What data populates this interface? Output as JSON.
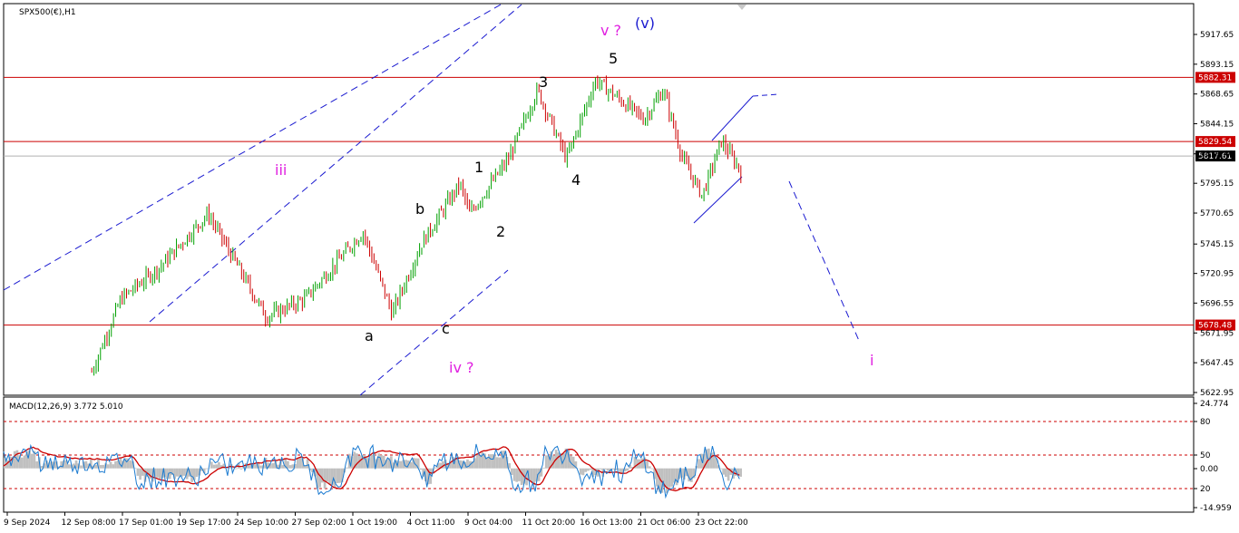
{
  "window": {
    "symbol_label": "SPX500(€),H1",
    "indicator_label": "MACD(12,26,9) 3.772 5.010"
  },
  "chart_data": [
    {
      "type": "candlestick",
      "title": "SPX500(€),H1",
      "ylim": [
        5622.95,
        5935
      ],
      "y_ticks": [
        "5917.65",
        "5893.15",
        "5868.65",
        "5844.15",
        "5819.40",
        "5795.15",
        "5770.65",
        "5745.15",
        "5720.95",
        "5696.55",
        "5671.95",
        "5647.45",
        "5622.95"
      ],
      "x_ticks": [
        "9 Sep 2024",
        "12 Sep 08:00",
        "17 Sep 01:00",
        "19 Sep 17:00",
        "24 Sep 10:00",
        "27 Sep 02:00",
        "1 Oct 19:00",
        "4 Oct 11:00",
        "9 Oct 04:00",
        "11 Oct 20:00",
        "16 Oct 13:00",
        "21 Oct 06:00",
        "23 Oct 22:00"
      ],
      "horizontal_levels": [
        {
          "price": 5882.31,
          "label": "5882.31",
          "color": "#cc0000"
        },
        {
          "price": 5829.54,
          "label": "5829.54",
          "color": "#cc0000"
        },
        {
          "price": 5817.61,
          "label": "5817.61",
          "color": "#000000"
        },
        {
          "price": 5678.48,
          "label": "5678.48",
          "color": "#cc0000"
        }
      ],
      "key_points": [
        {
          "x": 0,
          "price": 5640
        },
        {
          "x": 3,
          "price": 5700
        },
        {
          "x": 7,
          "price": 5726
        },
        {
          "x": 12,
          "price": 5770
        },
        {
          "x": 18,
          "price": 5685
        },
        {
          "x": 22,
          "price": 5700
        },
        {
          "x": 28,
          "price": 5755
        },
        {
          "x": 31,
          "price": 5688
        },
        {
          "x": 34,
          "price": 5745
        },
        {
          "x": 38,
          "price": 5795
        },
        {
          "x": 39,
          "price": 5770
        },
        {
          "x": 43,
          "price": 5815
        },
        {
          "x": 46,
          "price": 5872
        },
        {
          "x": 49,
          "price": 5815
        },
        {
          "x": 52,
          "price": 5880
        },
        {
          "x": 57,
          "price": 5848
        },
        {
          "x": 59,
          "price": 5872
        },
        {
          "x": 61,
          "price": 5815
        },
        {
          "x": 63,
          "price": 5785
        },
        {
          "x": 65,
          "price": 5830
        },
        {
          "x": 67,
          "price": 5805
        }
      ],
      "wave_labels": [
        {
          "text": "iii",
          "color": "#e020e0"
        },
        {
          "text": "a",
          "color": "#000000"
        },
        {
          "text": "b",
          "color": "#000000"
        },
        {
          "text": "c",
          "color": "#000000"
        },
        {
          "text": "iv ?",
          "color": "#e020e0"
        },
        {
          "text": "1",
          "color": "#000000"
        },
        {
          "text": "2",
          "color": "#000000"
        },
        {
          "text": "3",
          "color": "#000000"
        },
        {
          "text": "4",
          "color": "#000000"
        },
        {
          "text": "5",
          "color": "#000000"
        },
        {
          "text": "v ?",
          "color": "#e020e0"
        },
        {
          "text": "(v)",
          "color": "#1a1ad0"
        },
        {
          "text": "i",
          "color": "#e020e0"
        }
      ],
      "colors": {
        "up": "#00a000",
        "down": "#cc0000",
        "trendline": "#1a1ad0"
      }
    },
    {
      "type": "macd",
      "title": "MACD(12,26,9) 3.772 5.010",
      "params": [
        12,
        26,
        9
      ],
      "macd": 3.772,
      "signal": 5.01,
      "y_ticks": [
        "24.774",
        "80",
        "50",
        "0.00",
        "20",
        "-14.959"
      ],
      "levels": [
        80,
        50,
        20
      ],
      "colors": {
        "histogram": "#c0c0c0",
        "signal": "#cc0000",
        "main": "#1a7ad0",
        "level": "#cc0000"
      }
    }
  ]
}
